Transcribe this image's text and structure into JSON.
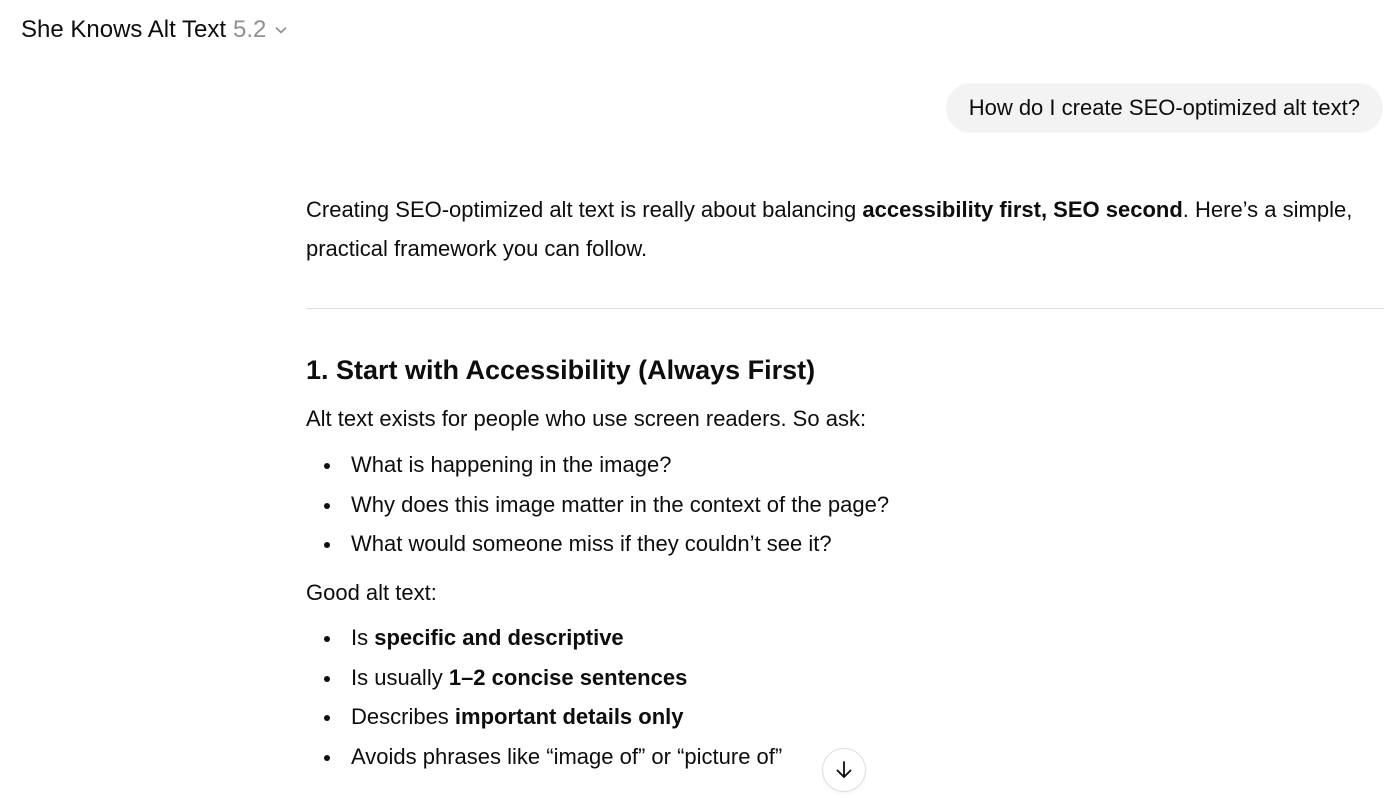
{
  "header": {
    "app_name": "She Knows Alt Text",
    "version": "5.2"
  },
  "conversation": {
    "user_message": "How do I create SEO-optimized alt text?",
    "assistant": {
      "intro_prefix": "Creating SEO-optimized alt text is really about balancing ",
      "intro_bold": "accessibility first, SEO second",
      "intro_suffix": ". Here’s a simple, practical framework you can follow.",
      "section_heading": "1. Start with Accessibility (Always First)",
      "section_intro": "Alt text exists for people who use screen readers. So ask:",
      "questions": [
        "What is happening in the image?",
        "Why does this image matter in the context of the page?",
        "What would someone miss if they couldn’t see it?"
      ],
      "good_alt_label": "Good alt text:",
      "good_traits": [
        {
          "prefix": "Is ",
          "bold": "specific and descriptive"
        },
        {
          "prefix": "Is usually ",
          "bold": "1–2 concise sentences"
        },
        {
          "prefix": "Describes ",
          "bold": "important details only"
        },
        {
          "prefix": "Avoids phrases like “image of” or “picture of”",
          "bold": ""
        }
      ]
    }
  },
  "icons": {
    "version_dropdown": "chevron-down-icon",
    "scroll_down": "arrow-down-icon"
  },
  "colors": {
    "text": "#0d0d0d",
    "muted": "#8f8f8f",
    "bubble_bg": "#f3f3f3",
    "divider": "#dcdcdc"
  }
}
